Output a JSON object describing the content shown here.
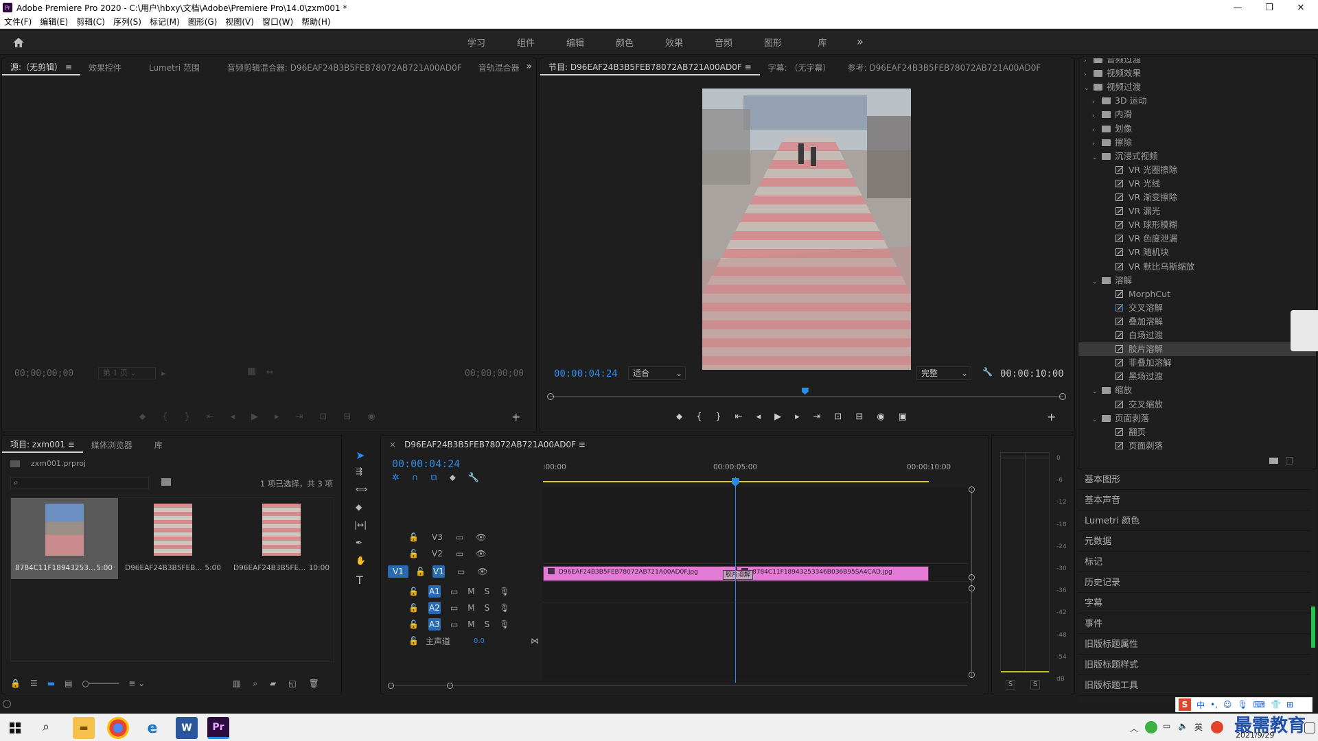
{
  "window": {
    "title": "Adobe Premiere Pro 2020 - C:\\用户\\hbxy\\文档\\Adobe\\Premiere Pro\\14.0\\zxm001 *",
    "logo": "Pr"
  },
  "menu": [
    "文件(F)",
    "编辑(E)",
    "剪辑(C)",
    "序列(S)",
    "标记(M)",
    "图形(G)",
    "视图(V)",
    "窗口(W)",
    "帮助(H)"
  ],
  "workspaces": [
    "学习",
    "组件",
    "编辑",
    "颜色",
    "效果",
    "音频",
    "图形",
    "库"
  ],
  "source_panel": {
    "tabs": [
      "源:（无剪辑）",
      "效果控件",
      "Lumetri 范围",
      "音频剪辑混合器: D96EAF24B3B5FEB78072AB721A00AD0F",
      "音轨混合器"
    ],
    "tc_left": "00;00;00;00",
    "tc_right": "00;00;00;00",
    "page": "第 1 页"
  },
  "program_panel": {
    "tabs": [
      "节目: D96EAF24B3B5FEB78072AB721A00AD0F",
      "字幕: （无字幕）",
      "参考: D96EAF24B3B5FEB78072AB721A00AD0F"
    ],
    "timecode": "00:00:04:24",
    "fit": "适合",
    "quality": "完整",
    "duration": "00:00:10:00",
    "playhead_fraction": 0.497
  },
  "effects_tree": {
    "items": [
      {
        "label": "音频过渡",
        "type": "folder",
        "level": 0
      },
      {
        "label": "视频效果",
        "type": "folder",
        "level": 0
      },
      {
        "label": "视频过渡",
        "type": "folder",
        "level": 0,
        "open": true
      },
      {
        "label": "3D 运动",
        "type": "folder",
        "level": 1
      },
      {
        "label": "内滑",
        "type": "folder",
        "level": 1
      },
      {
        "label": "划像",
        "type": "folder",
        "level": 1
      },
      {
        "label": "擦除",
        "type": "folder",
        "level": 1
      },
      {
        "label": "沉浸式视频",
        "type": "folder",
        "level": 1,
        "open": true
      },
      {
        "label": "VR 光圈擦除",
        "type": "fx",
        "level": 2
      },
      {
        "label": "VR 光线",
        "type": "fx",
        "level": 2
      },
      {
        "label": "VR 渐变擦除",
        "type": "fx",
        "level": 2
      },
      {
        "label": "VR 漏光",
        "type": "fx",
        "level": 2
      },
      {
        "label": "VR 球形模糊",
        "type": "fx",
        "level": 2
      },
      {
        "label": "VR 色度泄漏",
        "type": "fx",
        "level": 2
      },
      {
        "label": "VR 随机块",
        "type": "fx",
        "level": 2
      },
      {
        "label": "VR 默比乌斯缩放",
        "type": "fx",
        "level": 2
      },
      {
        "label": "溶解",
        "type": "folder",
        "level": 1,
        "open": true
      },
      {
        "label": "MorphCut",
        "type": "fx",
        "level": 2
      },
      {
        "label": "交叉溶解",
        "type": "fx",
        "level": 2,
        "boxed": true
      },
      {
        "label": "叠加溶解",
        "type": "fx",
        "level": 2
      },
      {
        "label": "白场过渡",
        "type": "fx",
        "level": 2
      },
      {
        "label": "胶片溶解",
        "type": "fx",
        "level": 2,
        "selected": true
      },
      {
        "label": "非叠加溶解",
        "type": "fx",
        "level": 2
      },
      {
        "label": "黑场过渡",
        "type": "fx",
        "level": 2
      },
      {
        "label": "缩放",
        "type": "folder",
        "level": 1,
        "open": true
      },
      {
        "label": "交叉缩放",
        "type": "fx",
        "level": 2
      },
      {
        "label": "页面剥落",
        "type": "folder",
        "level": 1,
        "open": true
      },
      {
        "label": "翻页",
        "type": "fx",
        "level": 2
      },
      {
        "label": "页面剥落",
        "type": "fx",
        "level": 2
      }
    ]
  },
  "side_panels": [
    "基本图形",
    "基本声音",
    "Lumetri 颜色",
    "元数据",
    "标记",
    "历史记录",
    "字幕",
    "事件",
    "旧版标题属性",
    "旧版标题样式",
    "旧版标题工具"
  ],
  "project_panel": {
    "tabs": [
      "项目: zxm001",
      "媒体浏览器",
      "库"
    ],
    "file": "zxm001.prproj",
    "selection": "1 项已选择，共 3 项",
    "items": [
      {
        "name": "8784C11F18943253...",
        "dur": "5:00",
        "selected": true
      },
      {
        "name": "D96EAF24B3B5FEB...",
        "dur": "5:00"
      },
      {
        "name": "D96EAF24B3B5FE...",
        "dur": "10:00"
      }
    ]
  },
  "timeline": {
    "sequence": "D96EAF24B3B5FEB78072AB721A00AD0F",
    "timecode": "00:00:04:24",
    "ruler": [
      ":00:00",
      "00:00:05:00",
      "00:00:10:00"
    ],
    "tracks_video": [
      "V3",
      "V2",
      "V1"
    ],
    "tracks_audio": [
      "A1",
      "A2",
      "A3"
    ],
    "src_patch": "V1",
    "master": {
      "label": "主声道",
      "value": "0.0"
    },
    "clip1": "D96EAF24B3B5FEB78072AB721A00AD0F.jpg",
    "clip2": "8784C11F18943253346B036B95SA4CAD.jpg",
    "transition": "胶片溶解",
    "clip_color": "#e37ad6",
    "playhead_seconds": 4.96
  },
  "audio_meter": {
    "scale": [
      "0",
      "-6",
      "-12",
      "-18",
      "-24",
      "-30",
      "-36",
      "-42",
      "-48",
      "-54",
      "dB"
    ],
    "solo": [
      "S",
      "S"
    ]
  },
  "taskbar": {
    "apps": [
      "explorer",
      "chrome",
      "edge",
      "word",
      "premiere"
    ],
    "tray_text": [
      "中",
      "英"
    ],
    "watermark": "最需教育",
    "date": "2021/9/29"
  }
}
